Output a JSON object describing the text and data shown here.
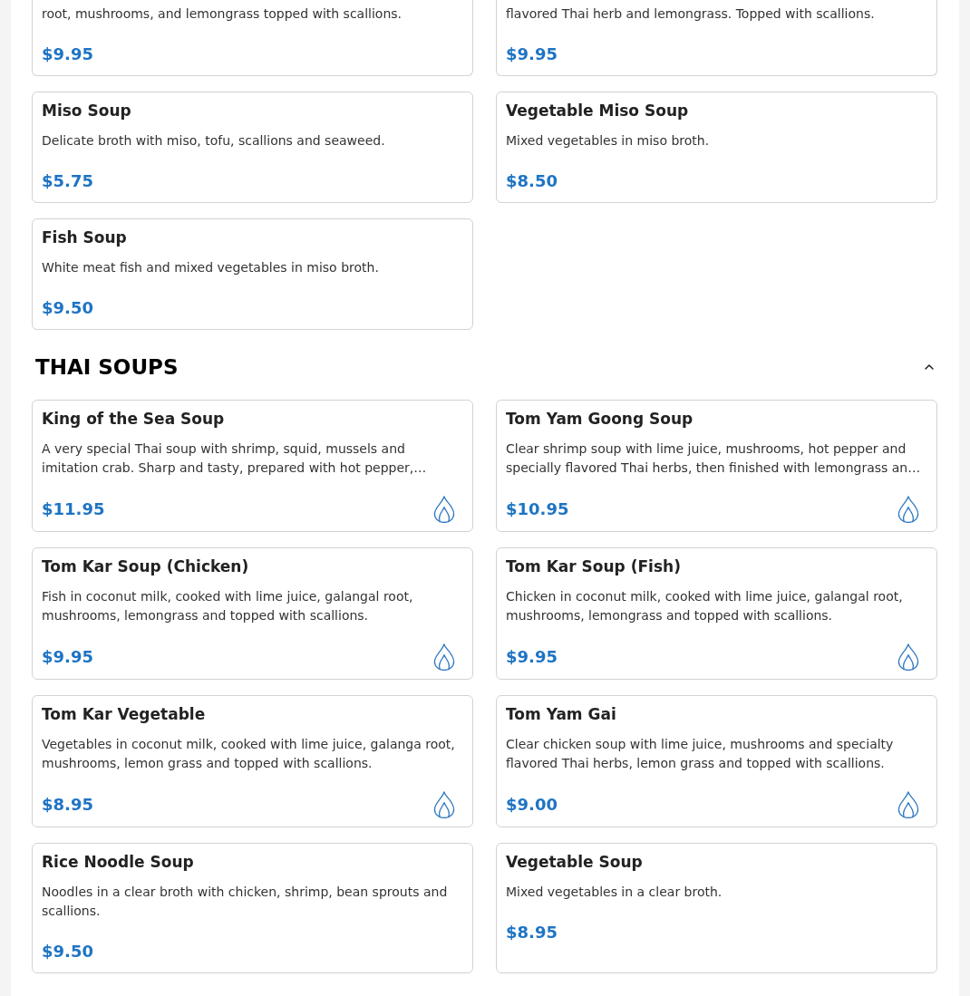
{
  "sections": [
    {
      "items": [
        {
          "description": "root, mushrooms, and lemongrass topped with scallions.",
          "price": "$9.95",
          "spicy": false
        },
        {
          "description": "flavored Thai herb and lemongrass. Topped with scallions.",
          "price": "$9.95",
          "spicy": false
        },
        {
          "name": "Miso Soup",
          "description": "Delicate broth with miso, tofu, scallions and seaweed.",
          "price": "$5.75",
          "spicy": false
        },
        {
          "name": "Vegetable Miso Soup",
          "description": "Mixed vegetables in miso broth.",
          "price": "$8.50",
          "spicy": false
        },
        {
          "name": "Fish Soup",
          "description": "White meat fish and mixed vegetables in miso broth.",
          "price": "$9.50",
          "spicy": false
        }
      ]
    },
    {
      "title": "THAI SOUPS",
      "expanded": true,
      "items": [
        {
          "name": "King of the Sea Soup",
          "description": "A very special Thai soup with shrimp, squid, mussels and imitation crab. Sharp and tasty, prepared with hot pepper,…",
          "price": "$11.95",
          "spicy": true
        },
        {
          "name": "Tom Yam Goong Soup",
          "description": "Clear shrimp soup with lime juice, mushrooms, hot pepper and specially flavored Thai herbs, then finished with lemongrass an…",
          "price": "$10.95",
          "spicy": true
        },
        {
          "name": "Tom Kar Soup (Chicken)",
          "description": "Fish in coconut milk, cooked with lime juice, galangal root, mushrooms, lemongrass and topped with scallions.",
          "price": "$9.95",
          "spicy": true
        },
        {
          "name": "Tom Kar Soup (Fish)",
          "description": "Chicken in coconut milk, cooked with lime juice, galangal root, mushrooms, lemongrass and topped with scallions.",
          "price": "$9.95",
          "spicy": true
        },
        {
          "name": "Tom Kar Vegetable",
          "description": "Vegetables in coconut milk, cooked with lime juice, galanga root, mushrooms, lemon grass and topped with scallions.",
          "price": "$8.95",
          "spicy": true
        },
        {
          "name": "Tom Yam Gai",
          "description": "Clear chicken soup with lime juice, mushrooms and specialty flavored Thai herbs, lemon grass and topped with scallions.",
          "price": "$9.00",
          "spicy": true
        },
        {
          "name": "Rice Noodle Soup",
          "description": "Noodles in a clear broth with chicken, shrimp, bean sprouts and scallions.",
          "price": "$9.50",
          "spicy": false
        },
        {
          "name": "Vegetable Soup",
          "description": "Mixed vegetables in a clear broth.",
          "price": "$8.95",
          "spicy": false
        }
      ]
    }
  ]
}
